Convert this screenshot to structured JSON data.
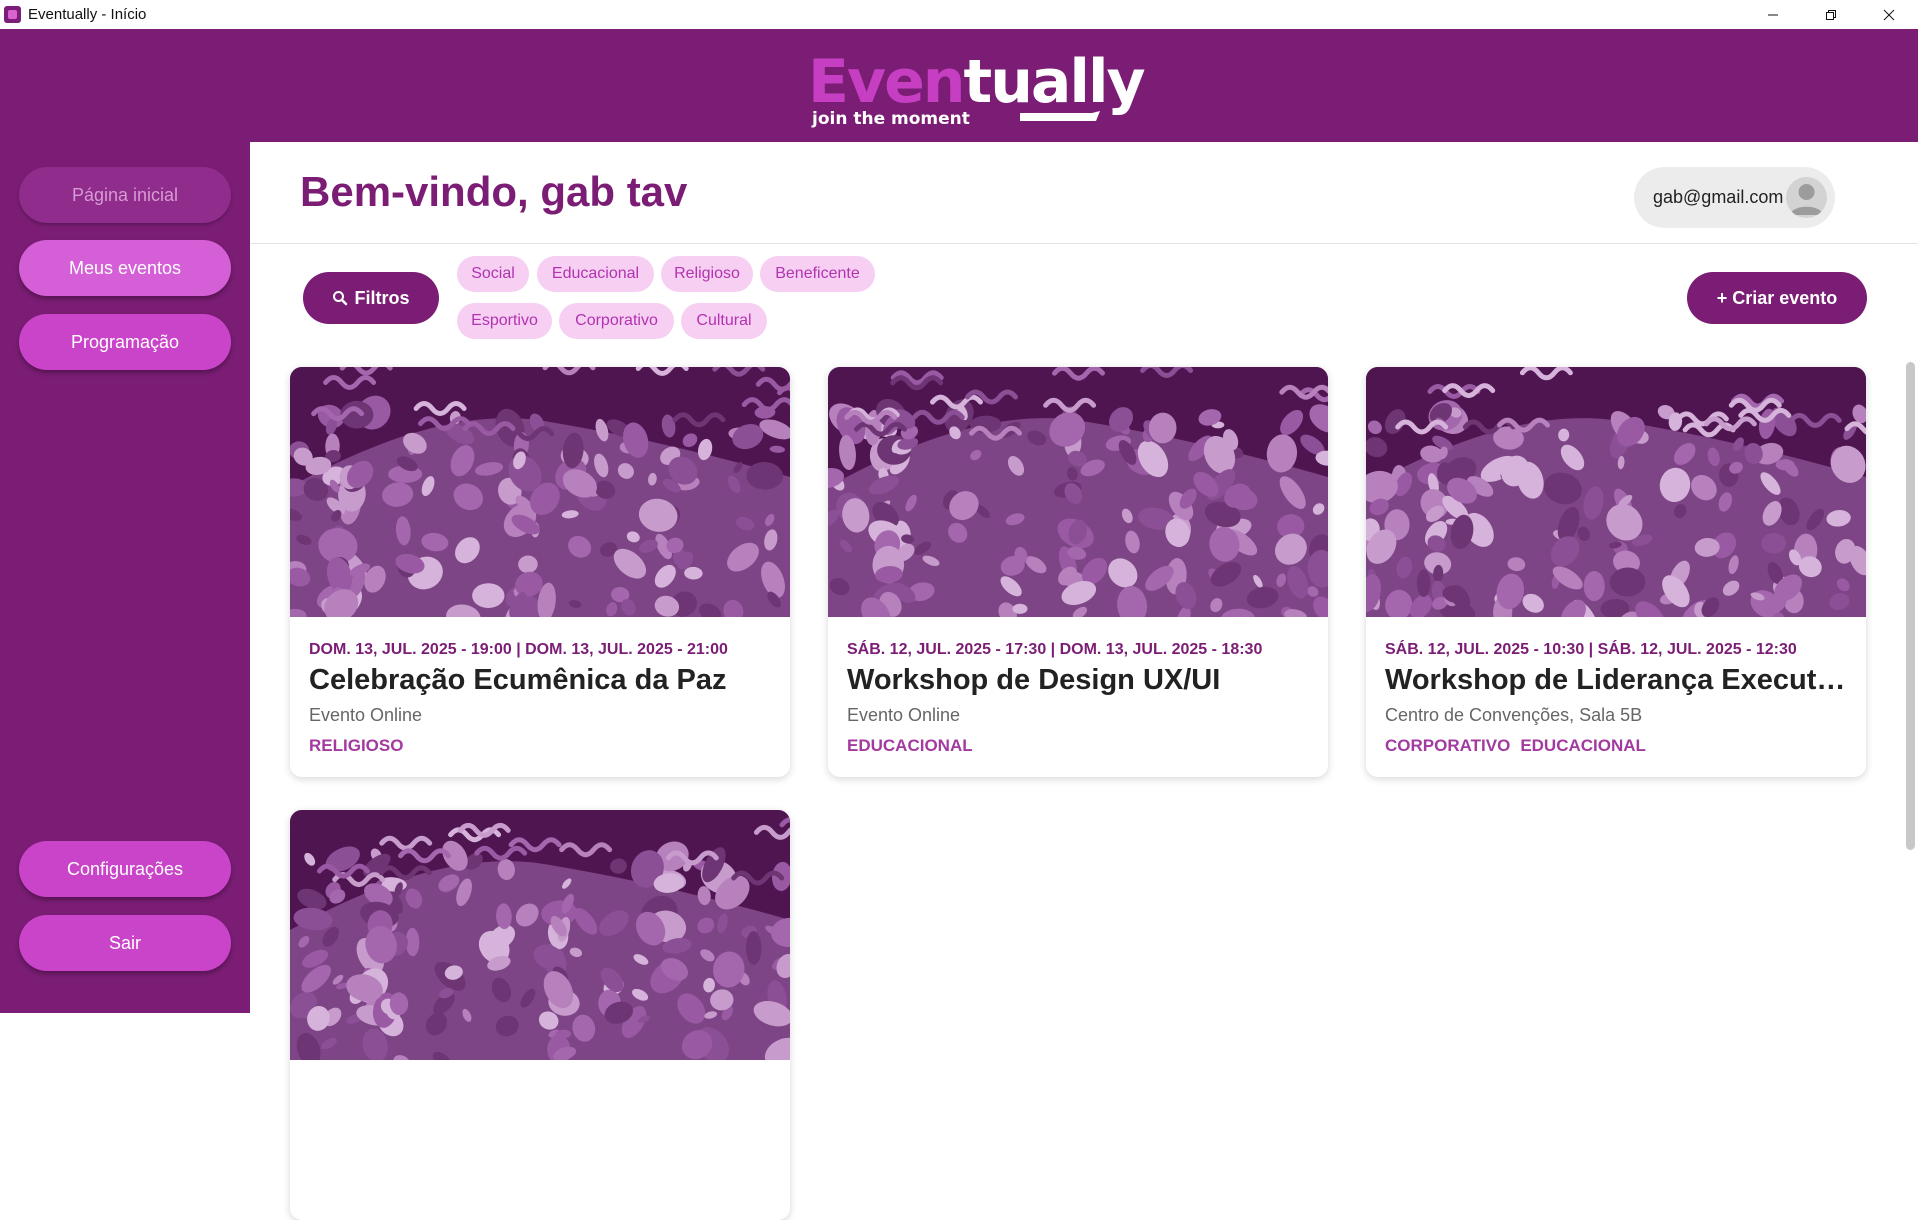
{
  "window": {
    "title": "Eventually - Início"
  },
  "brand": {
    "name_part1": "Even",
    "name_part2": "tually",
    "tagline": "join the moment"
  },
  "sidebar": {
    "items": [
      {
        "label": "Página inicial"
      },
      {
        "label": "Meus eventos"
      },
      {
        "label": "Programação"
      },
      {
        "label": "Configurações"
      },
      {
        "label": "Sair"
      }
    ]
  },
  "main": {
    "welcome": "Bem-vindo, gab tav",
    "user_email": "gab@gmail.com",
    "filters_label": "Filtros",
    "create_label": "+ Criar evento",
    "categories": [
      "Social",
      "Educacional",
      "Religioso",
      "Beneficente",
      "Esportivo",
      "Corporativo",
      "Cultural"
    ]
  },
  "events": [
    {
      "dates": "DOM. 13, JUL. 2025 - 19:00 | DOM. 13, JUL. 2025 - 21:00",
      "title": "Celebração Ecumênica da Paz",
      "location": "Evento Online",
      "categories": [
        "RELIGIOSO"
      ]
    },
    {
      "dates": "SÁB. 12, JUL. 2025 - 17:30 | DOM. 13, JUL. 2025 - 18:30",
      "title": "Workshop de Design UX/UI",
      "location": "Evento Online",
      "categories": [
        "EDUCACIONAL"
      ]
    },
    {
      "dates": "SÁB. 12, JUL. 2025 - 10:30 | SÁB. 12, JUL. 2025 - 12:30",
      "title": "Workshop de Liderança Executiva",
      "location": "Centro de Convenções, Sala 5B",
      "categories": [
        "CORPORATIVO",
        "EDUCACIONAL"
      ]
    },
    {
      "dates": "",
      "title": "",
      "location": "",
      "categories": []
    }
  ],
  "colors": {
    "brand_purple": "#7b1d75",
    "accent_pink": "#c944c9",
    "chip_bg": "#f6cff3",
    "chip_text": "#b233b0"
  }
}
